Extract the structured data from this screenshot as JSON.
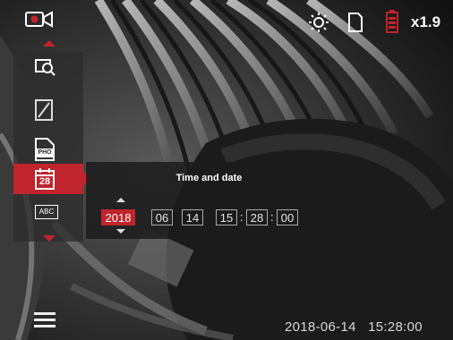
{
  "status_bar": {
    "zoom": "x1.9"
  },
  "menu": {
    "items": [
      {
        "icon": "image-zoom-icon"
      },
      {
        "icon": "no-display-icon"
      },
      {
        "icon": "file-format-icon",
        "badge": "PHO"
      },
      {
        "icon": "calendar-icon",
        "badge": "28",
        "active": true
      },
      {
        "icon": "text-stamp-icon",
        "badge": "ABC"
      }
    ]
  },
  "panel": {
    "title": "Time and date",
    "year": "2018",
    "month": "06",
    "day": "14",
    "hour": "15",
    "minute": "28",
    "second": "00"
  },
  "overlay": {
    "timestamp": "2018-06-14   15:28:00"
  },
  "colors": {
    "accent": "#c0242c",
    "panel": "#1c1c1c"
  }
}
